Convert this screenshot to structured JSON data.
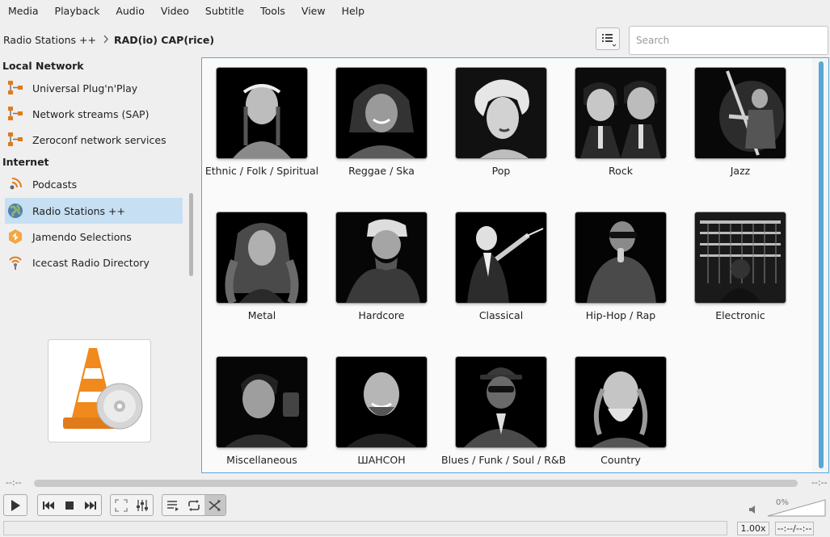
{
  "menu": [
    "Media",
    "Playback",
    "Audio",
    "Video",
    "Subtitle",
    "Tools",
    "View",
    "Help"
  ],
  "breadcrumb": {
    "parent": "Radio Stations ++",
    "current": "RAD(io) CAP(rice)"
  },
  "search": {
    "placeholder": "Search",
    "value": ""
  },
  "sidebar": {
    "sections": [
      {
        "title": "Local Network",
        "items": [
          {
            "label": "Universal Plug'n'Play",
            "icon": "network-icon"
          },
          {
            "label": "Network streams (SAP)",
            "icon": "network-icon"
          },
          {
            "label": "Zeroconf network services",
            "icon": "network-icon"
          }
        ]
      },
      {
        "title": "Internet",
        "items": [
          {
            "label": "Podcasts",
            "icon": "podcast-icon"
          },
          {
            "label": "Radio Stations ++",
            "icon": "globe-icon",
            "selected": true
          },
          {
            "label": "Jamendo Selections",
            "icon": "jamendo-icon"
          },
          {
            "label": "Icecast Radio Directory",
            "icon": "broadcast-icon"
          }
        ]
      }
    ]
  },
  "genres": [
    "Ethnic / Folk / Spiritual",
    "Reggae / Ska",
    "Pop",
    "Rock",
    "Jazz",
    "Metal",
    "Hardcore",
    "Classical",
    "Hip-Hop / Rap",
    "Electronic",
    "Miscellaneous",
    "ШАНСОН",
    "Blues / Funk / Soul / R&B",
    "Country"
  ],
  "player": {
    "elapsed": "--:--",
    "remaining": "--:--",
    "speed": "1.00x",
    "time_display": "--:--/--:--",
    "volume_label": "0%",
    "volume": 0
  },
  "colors": {
    "accent": "#5aa6d6",
    "selection": "#c6dff3",
    "vlc_orange": "#f08a1c"
  }
}
